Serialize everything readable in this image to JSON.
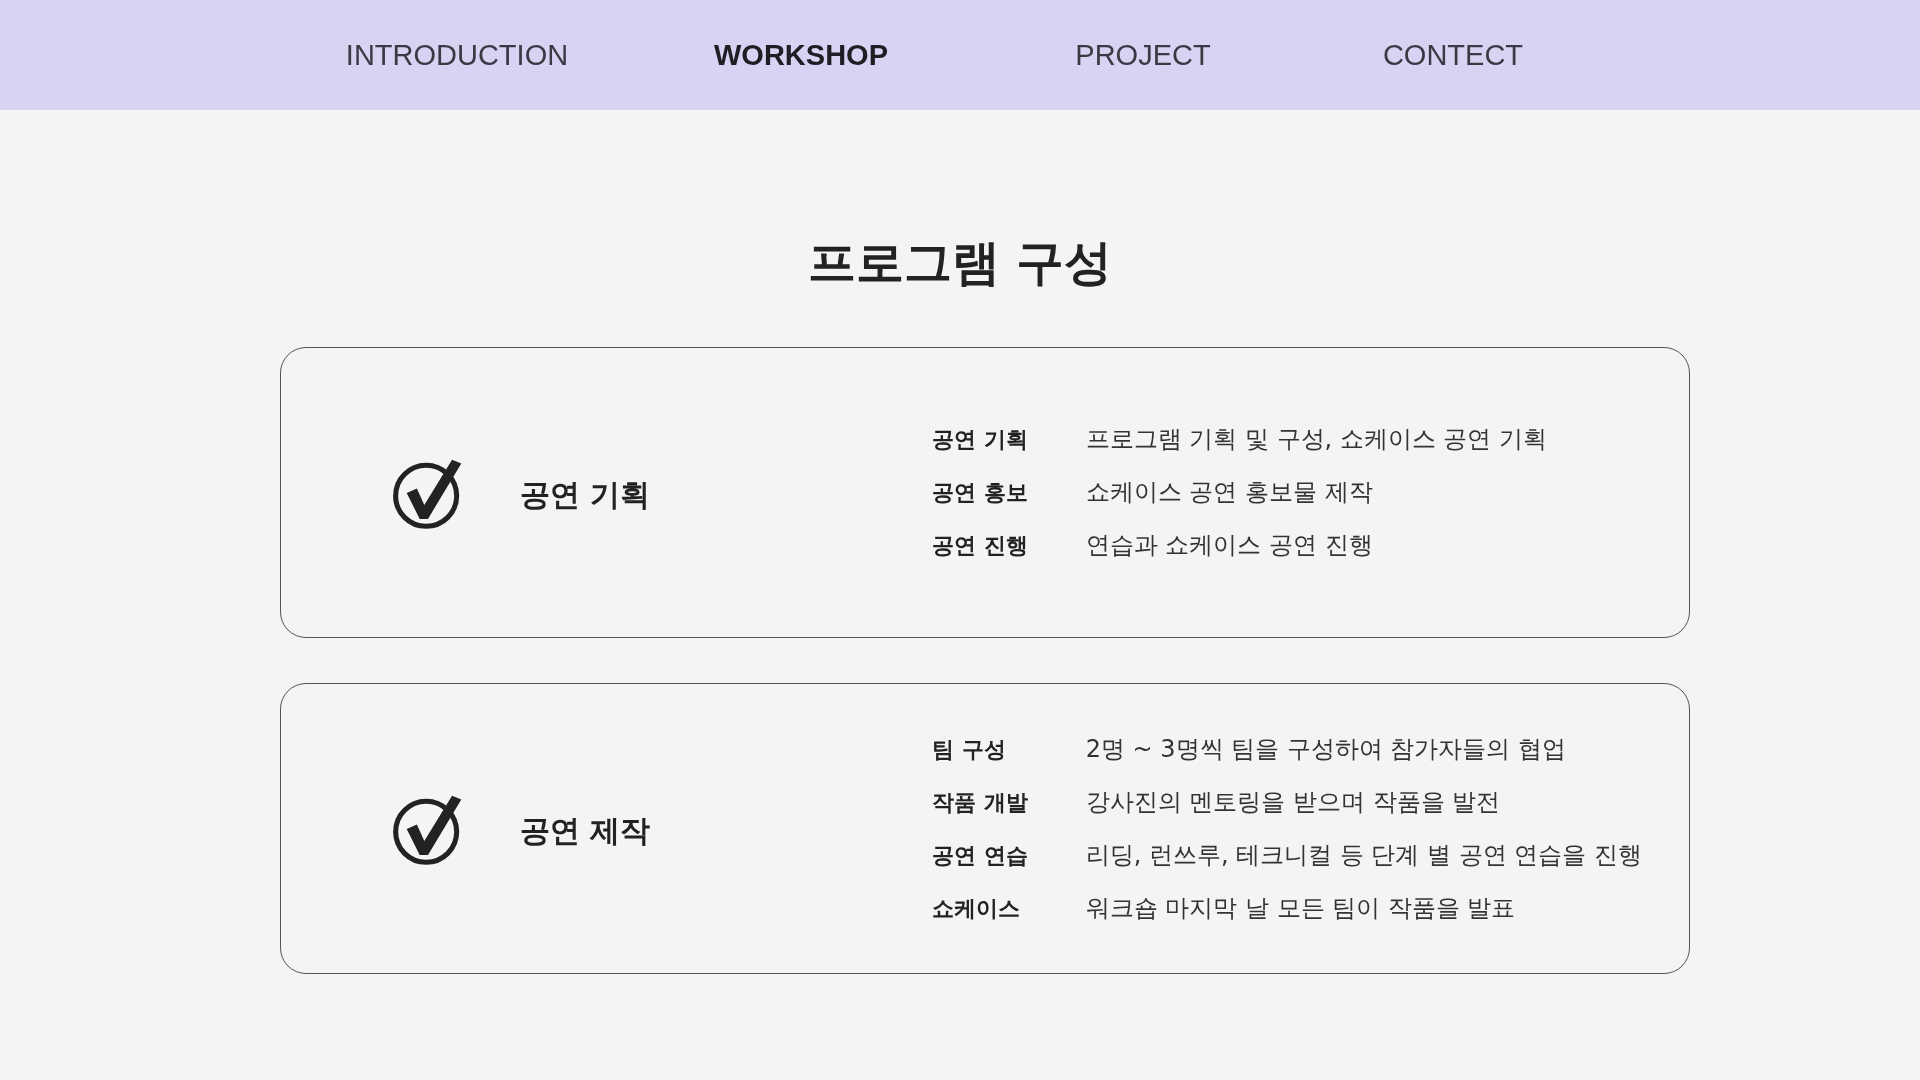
{
  "nav": {
    "tabs": [
      {
        "label": "INTRODUCTION",
        "selected": false
      },
      {
        "label": "WORKSHOP",
        "selected": true
      },
      {
        "label": "PROJECT",
        "selected": false
      },
      {
        "label": "CONTECT",
        "selected": false
      }
    ]
  },
  "title": "프로그램 구성",
  "sections": [
    {
      "title": "공연 기획",
      "items": [
        {
          "label": "공연 기획",
          "text": "프로그램 기획 및 구성, 쇼케이스 공연 기획"
        },
        {
          "label": "공연 홍보",
          "text": "쇼케이스 공연 홍보물 제작"
        },
        {
          "label": "공연 진행",
          "text": "연습과 쇼케이스 공연 진행"
        }
      ]
    },
    {
      "title": "공연 제작",
      "items": [
        {
          "label": "팀 구성",
          "text": "2명 ~ 3명씩 팀을 구성하여 참가자들의 협업"
        },
        {
          "label": "작품 개발",
          "text": "강사진의 멘토링을 받으며 작품을 발전"
        },
        {
          "label": "공연 연습",
          "text": "리딩, 런쓰루, 테크니컬 등 단계 별 공연 연습을 진행"
        },
        {
          "label": "쇼케이스",
          "text": "워크숍 마지막 날 모든 팀이 작품을 발표"
        }
      ]
    }
  ]
}
